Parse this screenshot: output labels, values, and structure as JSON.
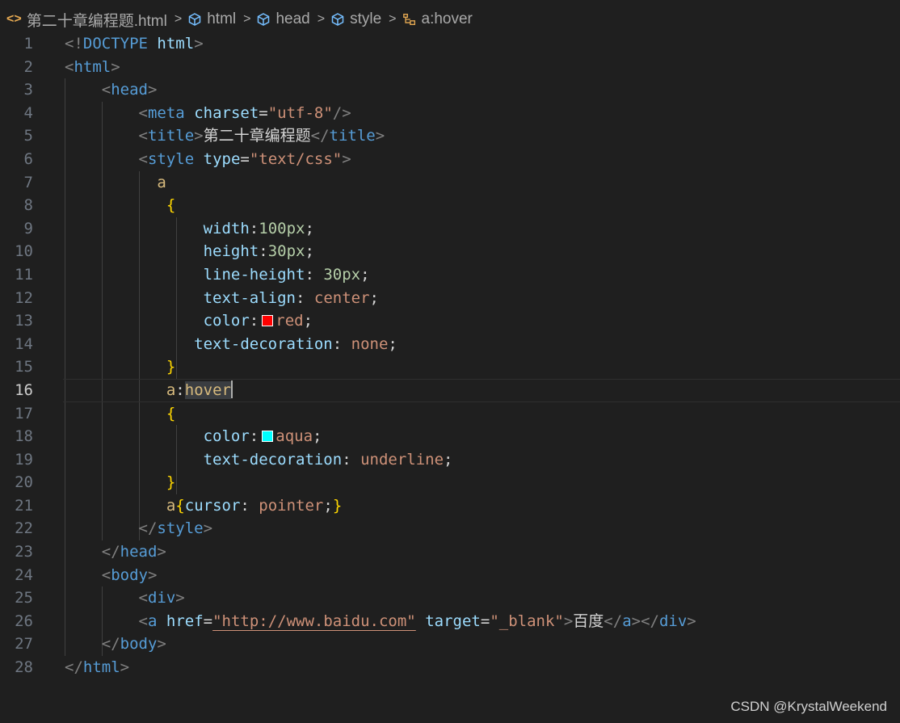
{
  "breadcrumb": {
    "file": "第二十章编程题.html",
    "items": [
      "html",
      "head",
      "style",
      "a:hover"
    ]
  },
  "editor": {
    "current_line": 16,
    "swatch_colors": {
      "red": "#ff0000",
      "aqua": "#00ffff"
    },
    "lines": [
      {
        "n": "1",
        "tokens": [
          [
            "punc",
            "<!"
          ],
          [
            "doctype",
            "DOCTYPE"
          ],
          [
            "text",
            " "
          ],
          [
            "attr",
            "html"
          ],
          [
            "punc",
            ">"
          ]
        ]
      },
      {
        "n": "2",
        "tokens": [
          [
            "punc",
            "<"
          ],
          [
            "tag",
            "html"
          ],
          [
            "punc",
            ">"
          ]
        ]
      },
      {
        "n": "3",
        "tokens": [
          [
            "text",
            "    "
          ],
          [
            "punc",
            "<"
          ],
          [
            "tag",
            "head"
          ],
          [
            "punc",
            ">"
          ]
        ]
      },
      {
        "n": "4",
        "tokens": [
          [
            "text",
            "        "
          ],
          [
            "punc",
            "<"
          ],
          [
            "tag",
            "meta"
          ],
          [
            "text",
            " "
          ],
          [
            "attr",
            "charset"
          ],
          [
            "text",
            "="
          ],
          [
            "str",
            "\"utf-8\""
          ],
          [
            "punc",
            "/>"
          ]
        ]
      },
      {
        "n": "5",
        "tokens": [
          [
            "text",
            "        "
          ],
          [
            "punc",
            "<"
          ],
          [
            "tag",
            "title"
          ],
          [
            "punc",
            ">"
          ],
          [
            "text",
            "第二十章编程题"
          ],
          [
            "punc",
            "</"
          ],
          [
            "tag",
            "title"
          ],
          [
            "punc",
            ">"
          ]
        ]
      },
      {
        "n": "6",
        "tokens": [
          [
            "text",
            "        "
          ],
          [
            "punc",
            "<"
          ],
          [
            "tag",
            "style"
          ],
          [
            "text",
            " "
          ],
          [
            "attr",
            "type"
          ],
          [
            "text",
            "="
          ],
          [
            "str",
            "\"text/css\""
          ],
          [
            "punc",
            ">"
          ]
        ]
      },
      {
        "n": "7",
        "tokens": [
          [
            "text",
            "          "
          ],
          [
            "sel",
            "a"
          ]
        ]
      },
      {
        "n": "8",
        "tokens": [
          [
            "text",
            "           "
          ],
          [
            "brace",
            "{"
          ]
        ]
      },
      {
        "n": "9",
        "tokens": [
          [
            "text",
            "               "
          ],
          [
            "prop",
            "width"
          ],
          [
            "text",
            ":"
          ],
          [
            "num",
            "100px"
          ],
          [
            "text",
            ";"
          ]
        ]
      },
      {
        "n": "10",
        "tokens": [
          [
            "text",
            "               "
          ],
          [
            "prop",
            "height"
          ],
          [
            "text",
            ":"
          ],
          [
            "num",
            "30px"
          ],
          [
            "text",
            ";"
          ]
        ]
      },
      {
        "n": "11",
        "tokens": [
          [
            "text",
            "               "
          ],
          [
            "prop",
            "line-height"
          ],
          [
            "text",
            ": "
          ],
          [
            "num",
            "30px"
          ],
          [
            "text",
            ";"
          ]
        ]
      },
      {
        "n": "12",
        "tokens": [
          [
            "text",
            "               "
          ],
          [
            "prop",
            "text-align"
          ],
          [
            "text",
            ": "
          ],
          [
            "val",
            "center"
          ],
          [
            "text",
            ";"
          ]
        ]
      },
      {
        "n": "13",
        "tokens": [
          [
            "text",
            "               "
          ],
          [
            "prop",
            "color"
          ],
          [
            "text",
            ":"
          ],
          [
            "swatch",
            "red"
          ],
          [
            "val",
            "red"
          ],
          [
            "text",
            ";"
          ]
        ]
      },
      {
        "n": "14",
        "tokens": [
          [
            "text",
            "              "
          ],
          [
            "prop",
            "text-decoration"
          ],
          [
            "text",
            ": "
          ],
          [
            "val",
            "none"
          ],
          [
            "text",
            ";"
          ]
        ]
      },
      {
        "n": "15",
        "tokens": [
          [
            "text",
            "           "
          ],
          [
            "brace",
            "}"
          ]
        ]
      },
      {
        "n": "16",
        "tokens": [
          [
            "text",
            "           "
          ],
          [
            "sel",
            "a"
          ],
          [
            "text",
            ":"
          ],
          [
            "hlsel",
            "hover"
          ],
          [
            "cursor",
            ""
          ]
        ]
      },
      {
        "n": "17",
        "tokens": [
          [
            "text",
            "           "
          ],
          [
            "brace",
            "{"
          ]
        ]
      },
      {
        "n": "18",
        "tokens": [
          [
            "text",
            "               "
          ],
          [
            "prop",
            "color"
          ],
          [
            "text",
            ":"
          ],
          [
            "swatch",
            "aqua"
          ],
          [
            "val",
            "aqua"
          ],
          [
            "text",
            ";"
          ]
        ]
      },
      {
        "n": "19",
        "tokens": [
          [
            "text",
            "               "
          ],
          [
            "prop",
            "text-decoration"
          ],
          [
            "text",
            ": "
          ],
          [
            "val",
            "underline"
          ],
          [
            "text",
            ";"
          ]
        ]
      },
      {
        "n": "20",
        "tokens": [
          [
            "text",
            "           "
          ],
          [
            "brace",
            "}"
          ]
        ]
      },
      {
        "n": "21",
        "tokens": [
          [
            "text",
            "           "
          ],
          [
            "sel",
            "a"
          ],
          [
            "brace",
            "{"
          ],
          [
            "prop",
            "cursor"
          ],
          [
            "text",
            ": "
          ],
          [
            "val",
            "pointer"
          ],
          [
            "text",
            ";"
          ],
          [
            "brace",
            "}"
          ]
        ]
      },
      {
        "n": "22",
        "tokens": [
          [
            "text",
            "        "
          ],
          [
            "punc",
            "</"
          ],
          [
            "tag",
            "style"
          ],
          [
            "punc",
            ">"
          ]
        ]
      },
      {
        "n": "23",
        "tokens": [
          [
            "text",
            "    "
          ],
          [
            "punc",
            "</"
          ],
          [
            "tag",
            "head"
          ],
          [
            "punc",
            ">"
          ]
        ]
      },
      {
        "n": "24",
        "tokens": [
          [
            "text",
            "    "
          ],
          [
            "punc",
            "<"
          ],
          [
            "tag",
            "body"
          ],
          [
            "punc",
            ">"
          ]
        ]
      },
      {
        "n": "25",
        "tokens": [
          [
            "text",
            "        "
          ],
          [
            "punc",
            "<"
          ],
          [
            "tag",
            "div"
          ],
          [
            "punc",
            ">"
          ]
        ]
      },
      {
        "n": "26",
        "tokens": [
          [
            "text",
            "        "
          ],
          [
            "punc",
            "<"
          ],
          [
            "tag",
            "a"
          ],
          [
            "text",
            " "
          ],
          [
            "attr",
            "href"
          ],
          [
            "text",
            "="
          ],
          [
            "link",
            "\"http://www.baidu.com\""
          ],
          [
            "text",
            " "
          ],
          [
            "attr",
            "target"
          ],
          [
            "text",
            "="
          ],
          [
            "str",
            "\"_blank\""
          ],
          [
            "punc",
            ">"
          ],
          [
            "text",
            "百度"
          ],
          [
            "punc",
            "</"
          ],
          [
            "tag",
            "a"
          ],
          [
            "punc",
            "></"
          ],
          [
            "tag",
            "div"
          ],
          [
            "punc",
            ">"
          ]
        ]
      },
      {
        "n": "27",
        "tokens": [
          [
            "text",
            "    "
          ],
          [
            "punc",
            "</"
          ],
          [
            "tag",
            "body"
          ],
          [
            "punc",
            ">"
          ]
        ]
      },
      {
        "n": "28",
        "tokens": [
          [
            "punc",
            "</"
          ],
          [
            "tag",
            "html"
          ],
          [
            "punc",
            ">"
          ]
        ]
      }
    ]
  },
  "watermark": "CSDN @KrystalWeekend"
}
